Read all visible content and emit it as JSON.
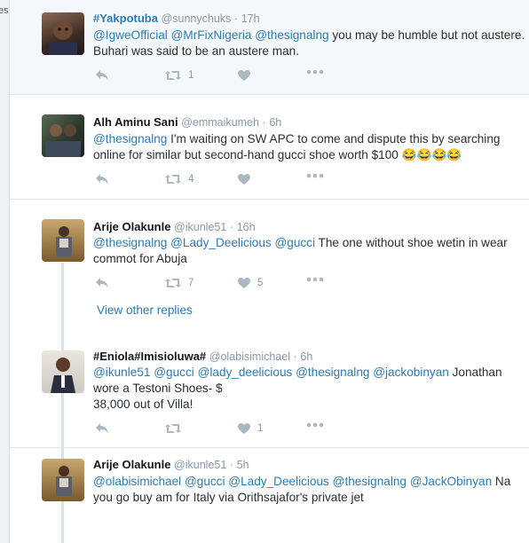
{
  "edge": {
    "text": "es"
  },
  "tweets": [
    {
      "name": "#Yakpotuba",
      "handle": "@sunnychuks",
      "dot": "·",
      "time": "17h",
      "body": [
        {
          "text": "@IgweOfficial",
          "link": true
        },
        {
          "text": " ",
          "link": false
        },
        {
          "text": "@MrFixNigeria",
          "link": true
        },
        {
          "text": " ",
          "link": false
        },
        {
          "text": "@thesignalng",
          "link": true
        },
        {
          "text": " you may be humble but not austere. Buhari was said to be an austere man.",
          "link": false
        }
      ],
      "retweets": "1",
      "likes": ""
    },
    {
      "name": "Alh Aminu Sani",
      "handle": "@emmaikumeh",
      "dot": "·",
      "time": "6h",
      "body": [
        {
          "text": "@thesignalng",
          "link": true
        },
        {
          "text": " I'm waiting on SW APC to come and dispute this by searching online for similar but second-hand gucci shoe worth $100",
          "link": false
        }
      ],
      "emoji": "😂😂😂😂",
      "retweets": "4",
      "likes": ""
    },
    {
      "name": "Arije Olakunle",
      "handle": "@ikunle51",
      "dot": "·",
      "time": "16h",
      "body": [
        {
          "text": "@thesignalng",
          "link": true
        },
        {
          "text": " ",
          "link": false
        },
        {
          "text": "@Lady_Deelicious",
          "link": true
        },
        {
          "text": " ",
          "link": false
        },
        {
          "text": "@gucci",
          "link": true
        },
        {
          "text": " The one without shoe wetin in wear commot for Abuja",
          "link": false
        }
      ],
      "retweets": "7",
      "likes": "5"
    },
    {
      "name": "#Eniola#Imisioluwa#",
      "handle": "@olabisimichael",
      "dot": "·",
      "time": "6h",
      "body": [
        {
          "text": "@ikunle51",
          "link": true
        },
        {
          "text": " ",
          "link": false
        },
        {
          "text": "@gucci",
          "link": true
        },
        {
          "text": " ",
          "link": false
        },
        {
          "text": "@lady_deelicious",
          "link": true
        },
        {
          "text": " ",
          "link": false
        },
        {
          "text": "@thesignalng",
          "link": true
        },
        {
          "text": " ",
          "link": false
        },
        {
          "text": "@jackobinyan",
          "link": true
        },
        {
          "text": " Jonathan wore a Testoni Shoes- $",
          "link": false
        },
        {
          "text": "\n38,000 out of Villa!",
          "link": false
        }
      ],
      "retweets": "",
      "likes": "1"
    },
    {
      "name": "Arije Olakunle",
      "handle": "@ikunle51",
      "dot": "·",
      "time": "5h",
      "body": [
        {
          "text": "@olabisimichael",
          "link": true
        },
        {
          "text": " ",
          "link": false
        },
        {
          "text": "@gucci",
          "link": true
        },
        {
          "text": " ",
          "link": false
        },
        {
          "text": "@Lady_Deelicious",
          "link": true
        },
        {
          "text": " ",
          "link": false
        },
        {
          "text": "@thesignalng",
          "link": true
        },
        {
          "text": " ",
          "link": false
        },
        {
          "text": "@JackObinyan",
          "link": true
        },
        {
          "text": " Na you go buy am for Italy via Orithsajafor's private jet",
          "link": false
        }
      ],
      "retweets": "",
      "likes": ""
    }
  ],
  "view_other_replies": "View other replies",
  "icons": {
    "reply": "reply-icon",
    "retweet": "retweet-icon",
    "like": "heart-icon",
    "more": "more-icon"
  }
}
